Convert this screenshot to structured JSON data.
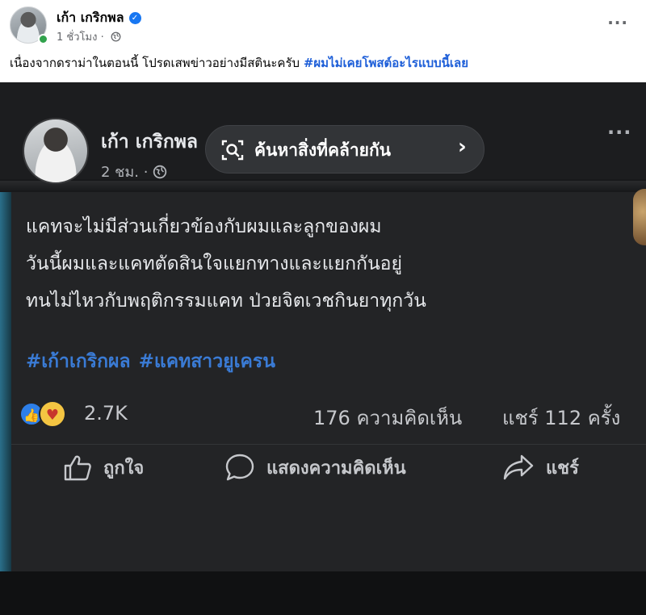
{
  "post": {
    "author": "เก้า เกริกพล",
    "verified": true,
    "time": "1 ชั่วโมง",
    "separator": "·",
    "more": "···",
    "caption": "เนื่องจากดราม่าในตอนนี้ โปรดเสพข่าวอย่างมีสตินะครับ",
    "caption_hashtag": "#ผมไม่เคยโพสต์อะไรแบบนี้เลย"
  },
  "embedded": {
    "author": "เก้า เกริกพล",
    "time": "2 ชม.",
    "separator": "·",
    "more": "···",
    "lens_label": "ค้นหาสิ่งที่คล้ายกัน",
    "lens_chevron": "›",
    "body_lines": [
      "แคทจะไม่มีส่วนเกี่ยวข้องกับผมและลูกของผม",
      "วันนี้ผมและแคทตัดสินใจแยกทางและแยกกันอยู่",
      "ทนไม่ไหวกับพฤติกรรมแคท ป่วยจิตเวชกินยาทุกวัน"
    ],
    "hashtags": [
      "#เก้าเกริกผล",
      "#แคทสาวยูเครน"
    ],
    "reaction_count": "2.7K",
    "comment_count": "176 ความคิดเห็น",
    "share_count": "แชร์ 112 ครั้ง",
    "actions": {
      "like": "ถูกใจ",
      "comment": "แสดงความคิดเห็น",
      "share": "แชร์"
    }
  },
  "colors": {
    "facebook_blue": "#1877f2",
    "hashtag_blue": "#1d5ed8",
    "dark_bg": "#232426",
    "online_green": "#31a24c"
  },
  "icons": [
    "verified-icon",
    "globe-icon",
    "more-icon",
    "lens-icon",
    "chevron-right-icon",
    "like-icon",
    "comment-icon",
    "share-icon"
  ]
}
